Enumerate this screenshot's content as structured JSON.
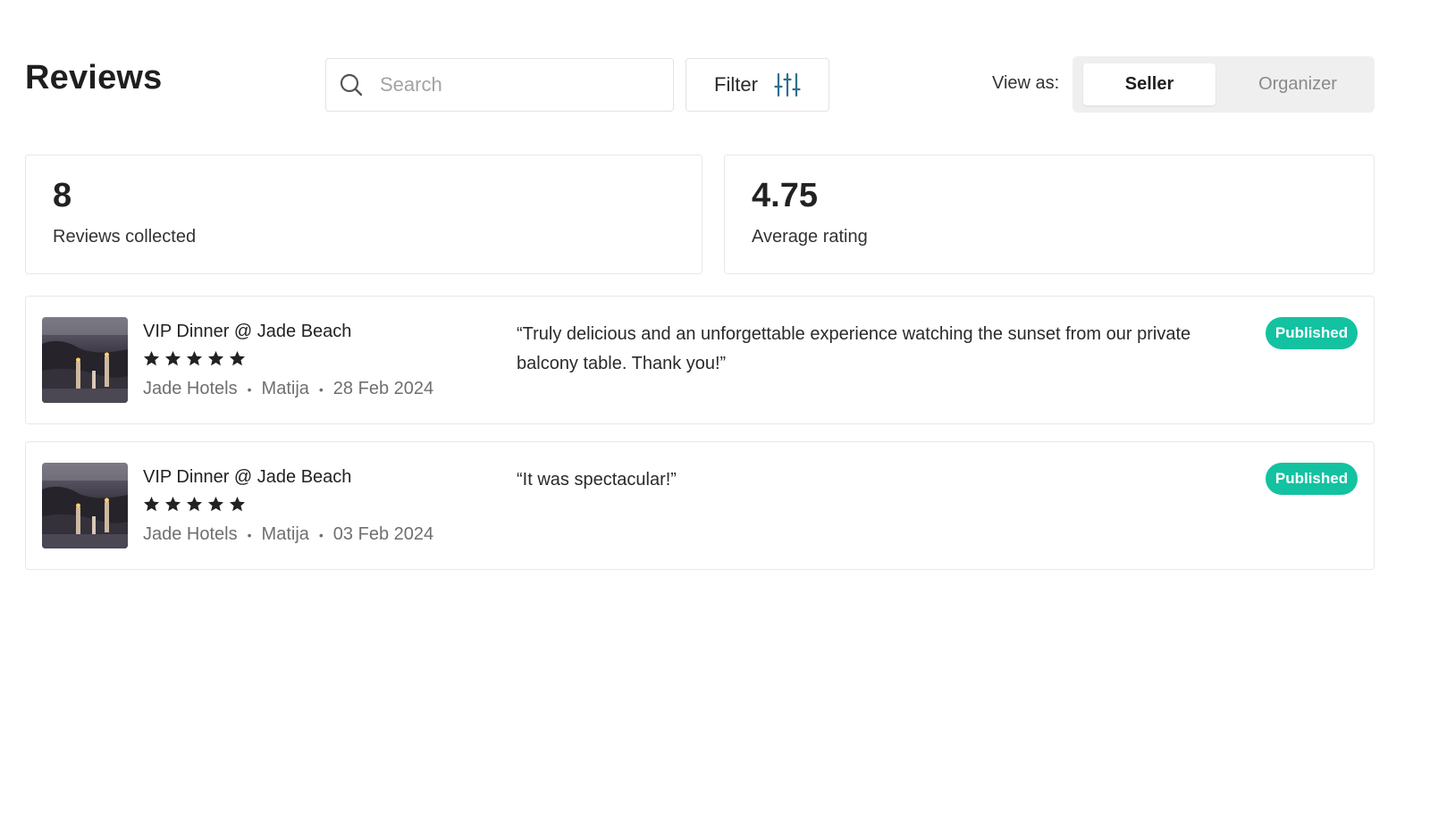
{
  "header": {
    "title": "Reviews",
    "search": {
      "placeholder": "Search",
      "value": ""
    },
    "filter_label": "Filter",
    "view_as": {
      "label": "View as:",
      "options": [
        "Seller",
        "Organizer"
      ],
      "selected": "Seller"
    }
  },
  "stats": [
    {
      "value": "8",
      "label": "Reviews collected"
    },
    {
      "value": "4.75",
      "label": "Average rating"
    }
  ],
  "reviews": [
    {
      "title": "VIP Dinner @ Jade Beach",
      "rating": 5,
      "provider": "Jade Hotels",
      "author": "Matija",
      "date": "28 Feb 2024",
      "quote": "“Truly delicious and an unforgettable experience watching the sunset from our private balcony table. Thank you!”",
      "status": "Published"
    },
    {
      "title": "VIP Dinner @ Jade Beach",
      "rating": 5,
      "provider": "Jade Hotels",
      "author": "Matija",
      "date": "03 Feb 2024",
      "quote": "“It was spectacular!”",
      "status": "Published"
    }
  ],
  "colors": {
    "published_badge": "#13c2a0",
    "filter_icon": "#2e6f8e",
    "text_primary": "#222222",
    "text_muted": "#6f6f6f"
  },
  "icons": {
    "search": "search-icon",
    "filter": "sliders-icon",
    "star": "star-icon"
  }
}
